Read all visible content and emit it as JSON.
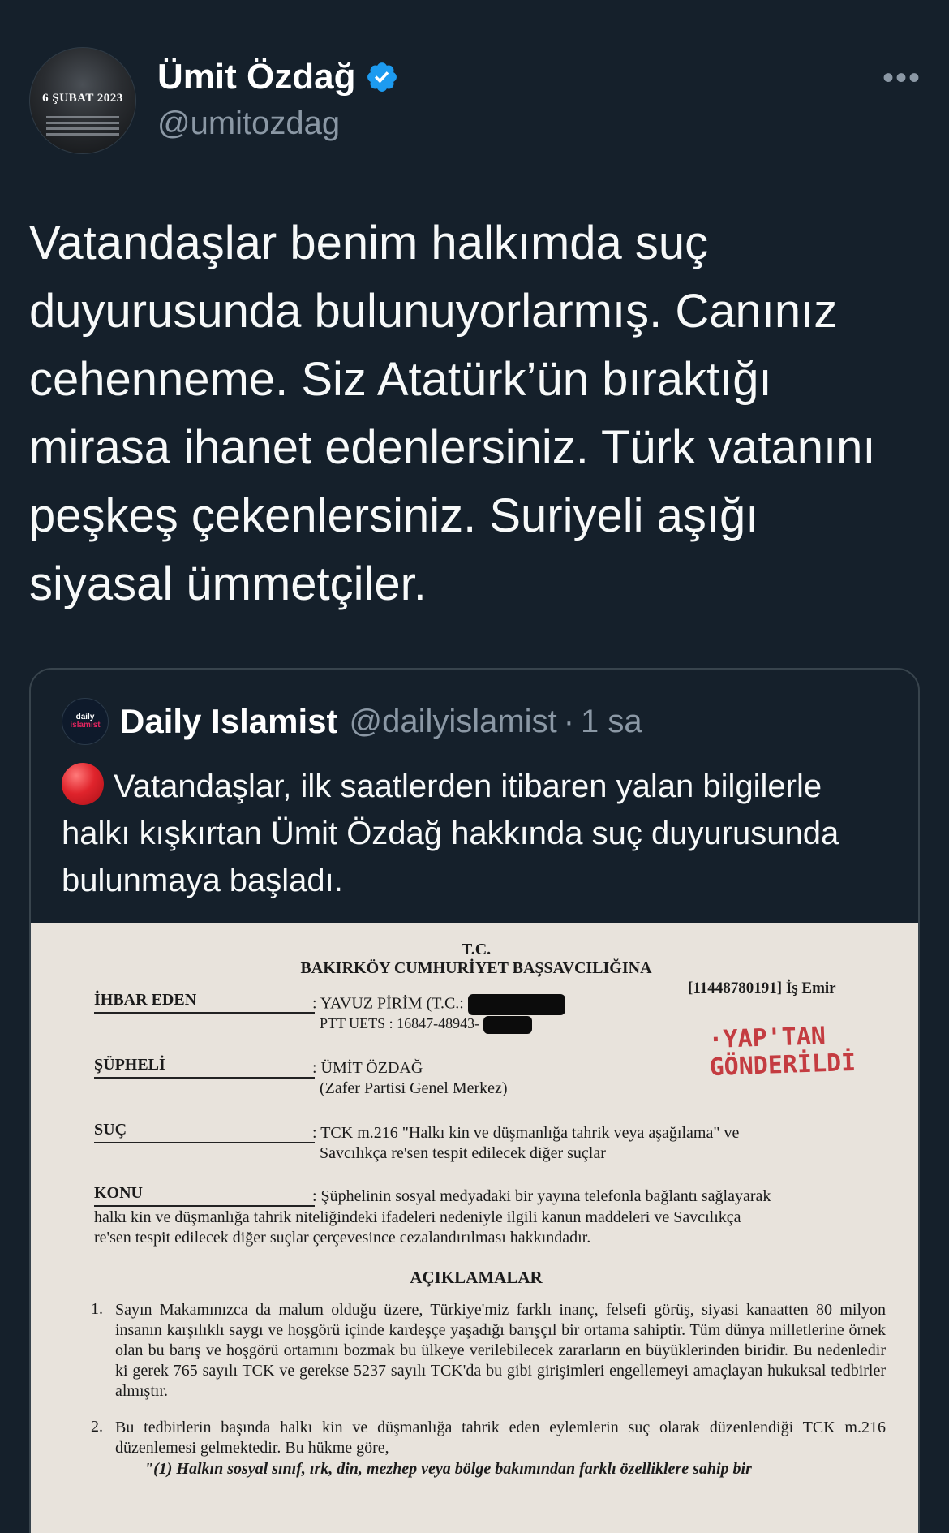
{
  "tweet": {
    "author": {
      "display_name": "Ümit Özdağ",
      "handle": "@umitozdag",
      "avatar_date": "6 ŞUBAT 2023",
      "verified": true,
      "verified_color": "#1d9bf0"
    },
    "more_icon": "more-horizontal-icon",
    "text": "Vatandaşlar benim halkımda suç duyurusunda bulunuyorlarmış. Canınız cehenneme. Siz Atatürk’ün bıraktığı mirasa ihanet edenlersiniz. Türk vatanını peşkeş çekenlersiniz. Suriyeli aşığı siyasal ümmetçiler."
  },
  "quote": {
    "avatar_text_1": "daily",
    "avatar_text_2": "islamist",
    "display_name": "Daily Islamist",
    "handle": "@dailyislamist",
    "separator": "·",
    "time": "1 sa",
    "emoji_icon": "red-circle-icon",
    "text": "Vatandaşlar, ilk saatlerden itibaren yalan bilgilerle halkı kışkırtan Ümit Özdağ hakkında suç duyurusunda bulunmaya başladı."
  },
  "document": {
    "header_line1": "T.C.",
    "header_line2": "BAKIRKÖY CUMHURİYET BAŞSAVCILIĞINA",
    "ref": "[11448780191] İş Emir",
    "stamp_line1": "·YAP'TAN",
    "stamp_line2": "GÖNDERİLDİ",
    "ihbar_label": "İHBAR EDEN",
    "ihbar_value": ": YAVUZ PİRİM (T.C.:",
    "ptt_value": "PTT UETS : 16847-48943-",
    "supheli_label": "ŞÜPHELİ",
    "supheli_value": ": ÜMİT ÖZDAĞ",
    "supheli_value2": "(Zafer Partisi Genel Merkez)",
    "suc_label": "SUÇ",
    "suc_value": ": TCK m.216 \"Halkı kin ve düşmanlığa tahrik veya aşağılama\" ve",
    "suc_value2": "Savcılıkça re'sen tespit edilecek diğer suçlar",
    "konu_label": "KONU",
    "konu_value": ": Şüphelinin sosyal medyadaki bir yayına telefonla bağlantı sağlayarak",
    "konu_value2": "halkı kin ve düşmanlığa tahrik niteliğindeki ifadeleri nedeniyle ilgili kanun maddeleri ve Savcılıkça",
    "konu_value3": "re'sen tespit edilecek diğer suçlar çerçevesince cezalandırılması hakkındadır.",
    "aciklamalar": "AÇIKLAMALAR",
    "p1_num": "1.",
    "p1": "Sayın Makamınızca da malum olduğu üzere, Türkiye'miz farklı inanç, felsefi görüş, siyasi kanaatten 80 milyon insanın karşılıklı saygı ve hoşgörü içinde kardeşçe yaşadığı barışçıl bir ortama sahiptir. Tüm dünya milletlerine örnek olan bu barış ve hoşgörü ortamını bozmak bu ülkeye verilebilecek zararların en büyüklerinden biridir. Bu nedenledir ki gerek 765 sayılı TCK ve gerekse 5237 sayılı TCK'da bu gibi girişimleri engellemeyi amaçlayan hukuksal tedbirler almıştır.",
    "p2_num": "2.",
    "p2": "Bu tedbirlerin başında halkı kin ve düşmanlığa tahrik eden eylemlerin suç olarak düzenlendiği TCK m.216 düzenlemesi gelmektedir. Bu hükme göre,",
    "p2_quote": "\"(1) Halkın sosyal sınıf, ırk, din, mezhep veya bölge bakımından farklı özelliklere sahip bir"
  }
}
